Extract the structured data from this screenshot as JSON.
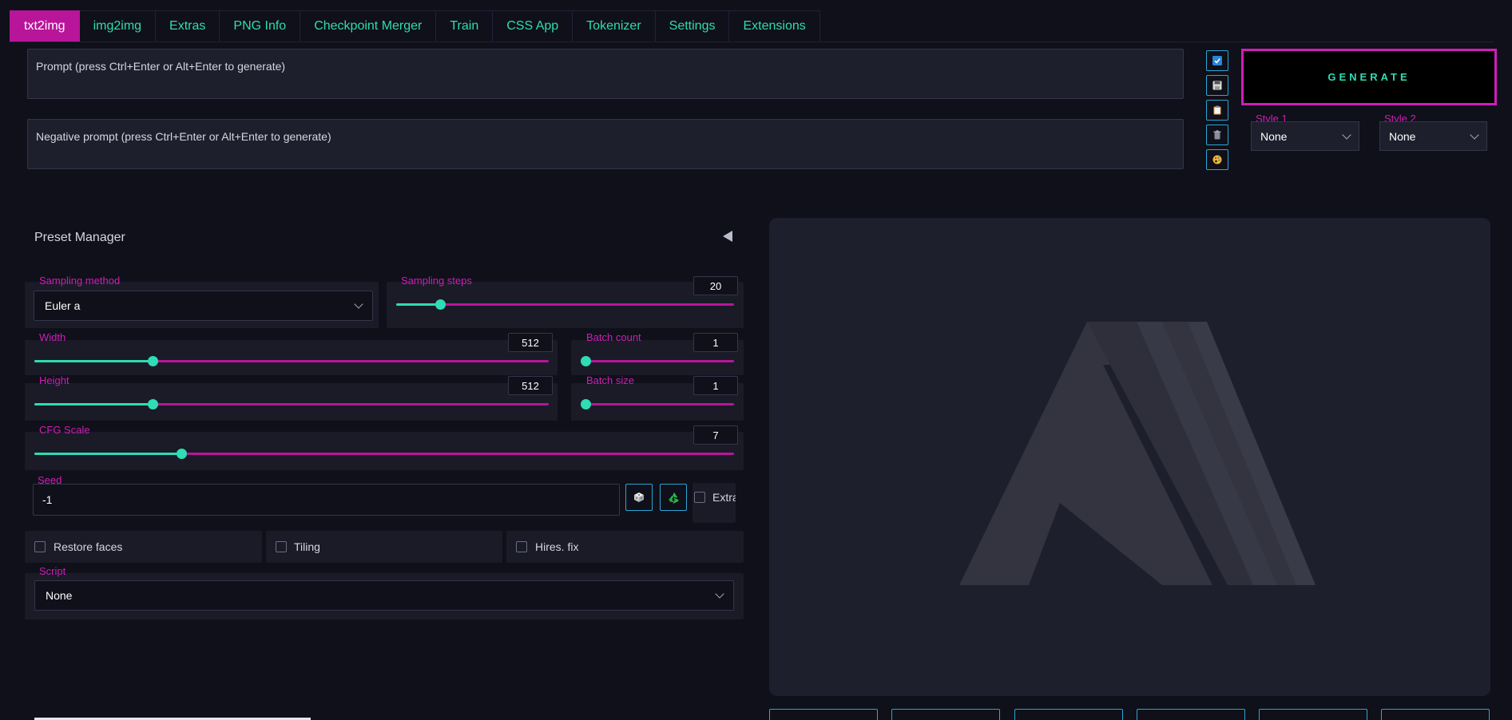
{
  "tabs": [
    {
      "label": "txt2img",
      "active": true
    },
    {
      "label": "img2img"
    },
    {
      "label": "Extras"
    },
    {
      "label": "PNG Info"
    },
    {
      "label": "Checkpoint Merger"
    },
    {
      "label": "Train"
    },
    {
      "label": "CSS App"
    },
    {
      "label": "Tokenizer"
    },
    {
      "label": "Settings"
    },
    {
      "label": "Extensions"
    }
  ],
  "prompt": {
    "placeholder": "Prompt (press Ctrl+Enter or Alt+Enter to generate)"
  },
  "negative_prompt": {
    "placeholder": "Negative prompt (press Ctrl+Enter or Alt+Enter to generate)"
  },
  "tools": [
    "check-icon",
    "save-icon",
    "clipboard-icon",
    "trash-icon",
    "palette-icon"
  ],
  "generate": {
    "label": "GENERATE"
  },
  "styles": [
    {
      "label": "Style 1",
      "value": "None"
    },
    {
      "label": "Style 2",
      "value": "None"
    }
  ],
  "preset_manager": {
    "title": "Preset Manager"
  },
  "sampling_method": {
    "label": "Sampling method",
    "value": "Euler a"
  },
  "sampling_steps": {
    "label": "Sampling steps",
    "value": "20",
    "fraction": 0.13
  },
  "width": {
    "label": "Width",
    "value": "512",
    "fraction": 0.23
  },
  "height": {
    "label": "Height",
    "value": "512",
    "fraction": 0.23
  },
  "batch_count": {
    "label": "Batch count",
    "value": "1",
    "fraction": 0.0
  },
  "batch_size": {
    "label": "Batch size",
    "value": "1",
    "fraction": 0.0
  },
  "cfg_scale": {
    "label": "CFG Scale",
    "value": "7",
    "fraction": 0.21
  },
  "seed": {
    "label": "Seed",
    "value": "-1",
    "extra_label": "Extra"
  },
  "checkboxes": [
    {
      "label": "Restore faces"
    },
    {
      "label": "Tiling"
    },
    {
      "label": "Hires. fix"
    }
  ],
  "script": {
    "label": "Script",
    "value": "None"
  },
  "colors": {
    "accent": "#b8159a",
    "teal": "#2fdcb4",
    "border_blue": "#2aa6d6"
  }
}
